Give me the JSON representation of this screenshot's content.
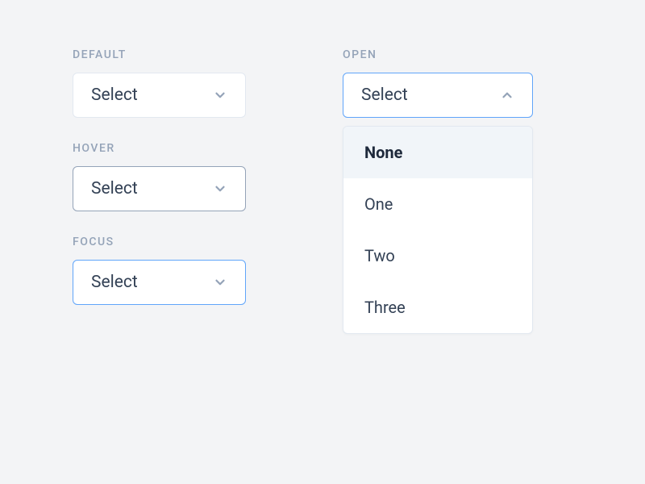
{
  "left": {
    "states": [
      {
        "label": "DEFAULT",
        "value": "Select",
        "variant": "default"
      },
      {
        "label": "HOVER",
        "value": "Select",
        "variant": "hover"
      },
      {
        "label": "FOCUS",
        "value": "Select",
        "variant": "focus"
      }
    ]
  },
  "right": {
    "label": "OPEN",
    "value": "Select",
    "options": [
      {
        "text": "None",
        "highlighted": true
      },
      {
        "text": "One",
        "highlighted": false
      },
      {
        "text": "Two",
        "highlighted": false
      },
      {
        "text": "Three",
        "highlighted": false
      }
    ]
  }
}
